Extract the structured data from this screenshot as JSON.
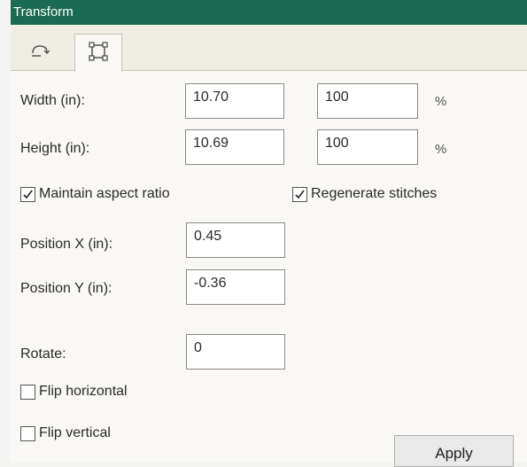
{
  "titlebar": {
    "title": "Transform"
  },
  "tabs": [
    {
      "icon": "rotate-icon"
    },
    {
      "icon": "resize-frame-icon",
      "selected": true
    }
  ],
  "width": {
    "label": "Width (in):",
    "value": "10.70",
    "percent": "100",
    "unit": "%"
  },
  "height": {
    "label": "Height (in):",
    "value": "10.69",
    "percent": "100",
    "unit": "%"
  },
  "options": {
    "maintain_aspect": {
      "label": "Maintain aspect ratio",
      "checked": true
    },
    "regenerate_stitches": {
      "label": "Regenerate stitches",
      "checked": true
    }
  },
  "position_x": {
    "label": "Position X (in):",
    "value": "0.45"
  },
  "position_y": {
    "label": "Position Y (in):",
    "value": "-0.36"
  },
  "rotate": {
    "label": "Rotate:",
    "value": "0"
  },
  "flip_horizontal": {
    "label": "Flip horizontal",
    "checked": false
  },
  "flip_vertical": {
    "label": "Flip vertical",
    "checked": false
  },
  "apply_button": {
    "label": "Apply"
  },
  "colors": {
    "titlebar": "#1b6b52",
    "panel": "#f9f8f4"
  }
}
